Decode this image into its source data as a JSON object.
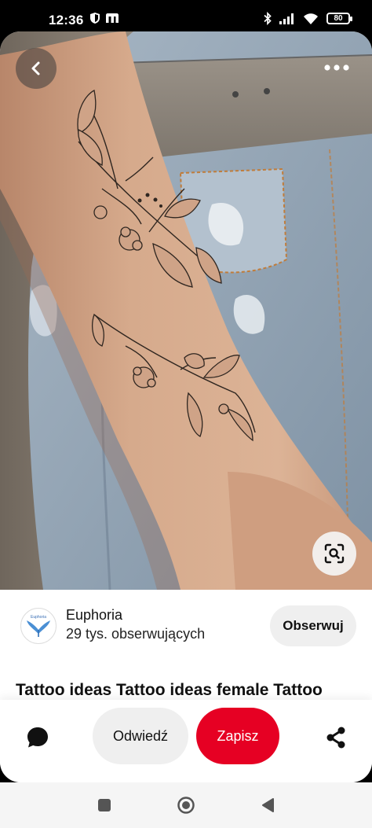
{
  "status_bar": {
    "time": "12:36",
    "battery": "80",
    "icons": [
      "shield-icon",
      "m-app-icon",
      "bluetooth-icon",
      "signal-icon",
      "wifi-icon",
      "battery-icon"
    ]
  },
  "pin": {
    "image_icon": "tattoo-photo",
    "title": "Tattoo ideas Tattoo ideas female Tattoo"
  },
  "creator": {
    "name": "Euphoria",
    "followers": "29 tys. obserwujących",
    "follow_label": "Obserwuj"
  },
  "actions": {
    "visit_label": "Odwiedź",
    "save_label": "Zapisz"
  },
  "colors": {
    "save_red": "#e60023",
    "pill_gray": "#efefef"
  }
}
